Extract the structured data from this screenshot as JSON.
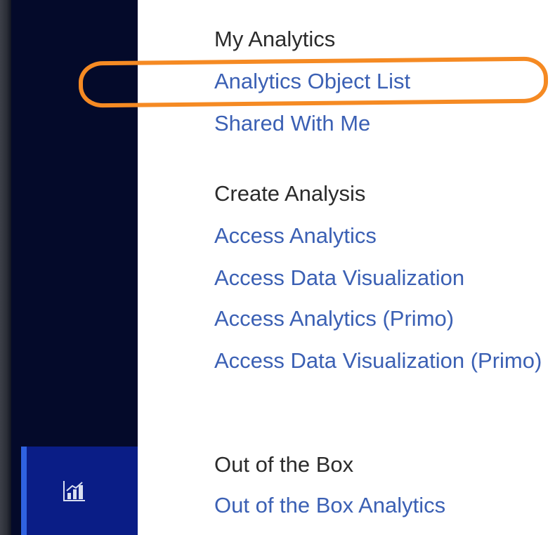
{
  "sections": [
    {
      "title": "My Analytics",
      "links": [
        "Analytics Object List",
        "Shared With Me"
      ]
    },
    {
      "title": "Create Analysis",
      "links": [
        "Access Analytics",
        "Access Data Visualization",
        "Access Analytics (Primo)",
        "Access Data Visualization (Primo)"
      ]
    },
    {
      "title": "Out of the Box",
      "links": [
        "Out of the Box Analytics"
      ]
    }
  ],
  "nav": {
    "active_item_icon": "analytics-chart-icon",
    "active_accent": "#2f62e0",
    "active_bg": "#0a1d86",
    "rail_bg": "#040a2a"
  },
  "highlight": {
    "target": "Analytics Object List",
    "color": "#f58a23"
  }
}
